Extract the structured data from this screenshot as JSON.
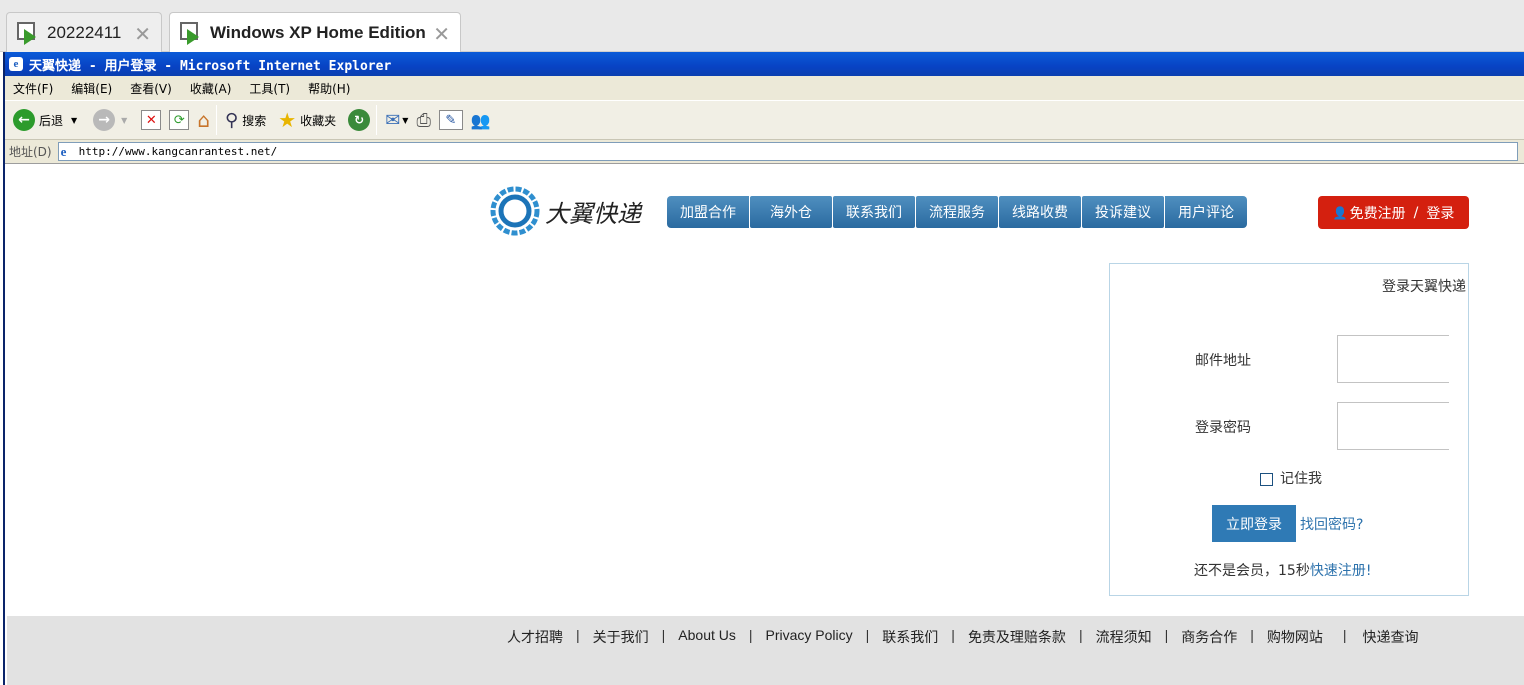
{
  "vm_tabs": [
    {
      "label": "20222411",
      "active": false
    },
    {
      "label": "Windows XP Home Edition",
      "active": true
    }
  ],
  "window": {
    "title": "天翼快递 - 用户登录 - Microsoft Internet Explorer"
  },
  "menu": [
    "文件(F)",
    "编辑(E)",
    "查看(V)",
    "收藏(A)",
    "工具(T)",
    "帮助(H)"
  ],
  "toolbar": {
    "back_label": "后退",
    "search_label": "搜索",
    "favorites_label": "收藏夹"
  },
  "address": {
    "label": "地址(D)",
    "url": "http://www.kangcanrantest.net/"
  },
  "site": {
    "logo_text": "大翼快递",
    "nav": [
      "加盟合作",
      "海外仓",
      "联系我们",
      "流程服务",
      "线路收费",
      "投诉建议",
      "用户评论"
    ],
    "register_label": "免费注册",
    "login_label": "登录",
    "login_box": {
      "title": "登录天翼快递",
      "email_label": "邮件地址",
      "password_label": "登录密码",
      "email_value": "",
      "password_value": "",
      "remember_label": "记住我",
      "remember_checked": false,
      "submit_label": "立即登录",
      "forgot_label": "找回密码?",
      "signup_prefix": "还不是会员，15秒",
      "signup_link": "快速注册!"
    },
    "footer_links": [
      "人才招聘",
      "关于我们",
      "About Us",
      "Privacy Policy",
      "联系我们",
      "免责及理赔条款",
      "流程须知",
      "商务合作",
      "购物网站",
      "快递查询"
    ]
  },
  "colors": {
    "nav_blue": "#2a6aa0",
    "register_red": "#d4200f",
    "link_blue": "#2e73ad",
    "title_blue": "#0843c4"
  }
}
